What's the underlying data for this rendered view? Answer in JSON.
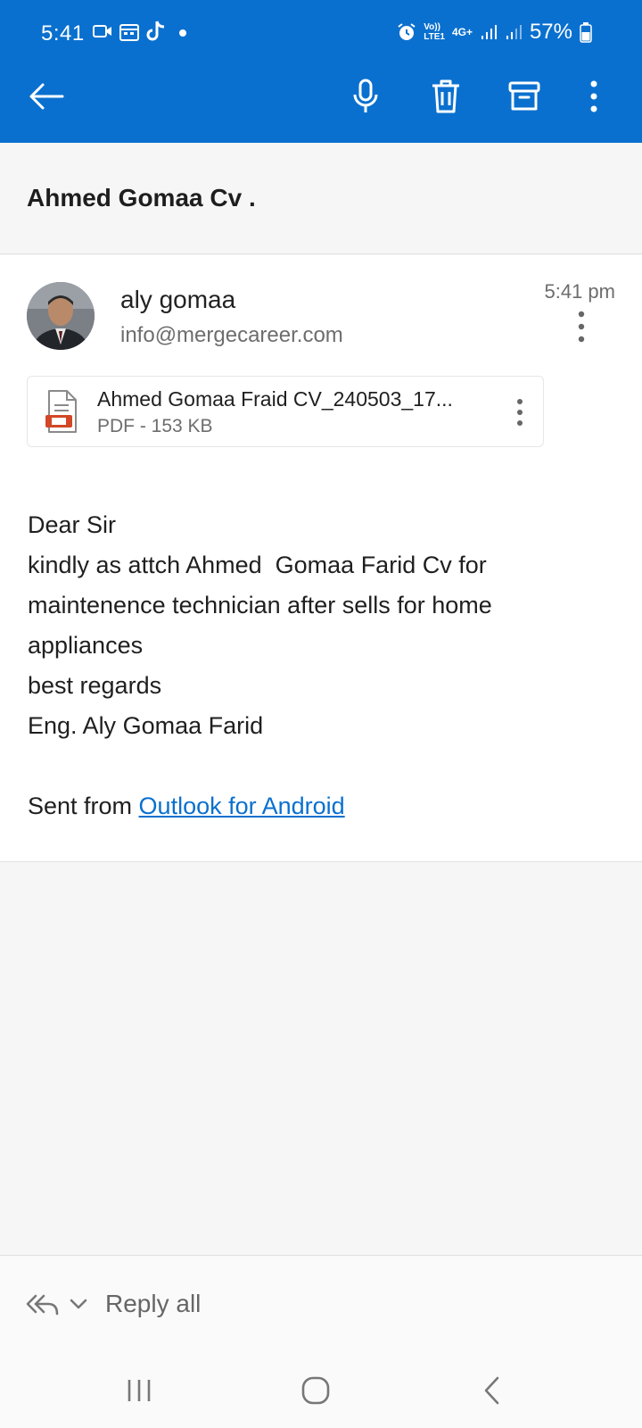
{
  "status_bar": {
    "time": "5:41",
    "battery": "57%",
    "network": "4G+",
    "lte_label": "LTE1",
    "volte_label": "Vo))",
    "icons": [
      "video-icon",
      "calendar-icon",
      "tiktok-icon",
      "dot-icon",
      "alarm-icon",
      "signal-icon",
      "signal-icon",
      "battery-icon"
    ]
  },
  "toolbar": {
    "icons": [
      "back-arrow-icon",
      "microphone-icon",
      "trash-icon",
      "archive-icon",
      "more-vert-icon"
    ]
  },
  "email": {
    "subject": "Ahmed Gomaa Cv .",
    "sender_name": "aly gomaa",
    "sender_email": "info@mergecareer.com",
    "time": "5:41 pm",
    "attachment": {
      "name": "Ahmed Gomaa Fraid CV_240503_17...",
      "meta": "PDF - 153 KB"
    },
    "body_lines": [
      "Dear Sir",
      "kindly as attch Ahmed  Gomaa Farid Cv for",
      "maintenence technician after sells for home",
      "appliances",
      "best regards",
      "Eng. Aly Gomaa Farid"
    ],
    "footer_prefix": "Sent from ",
    "footer_link": "Outlook for Android"
  },
  "reply_bar": {
    "label": "Reply all"
  },
  "colors": {
    "accent": "#0a70cf",
    "background": "#f6f6f6",
    "card": "#ffffff"
  }
}
